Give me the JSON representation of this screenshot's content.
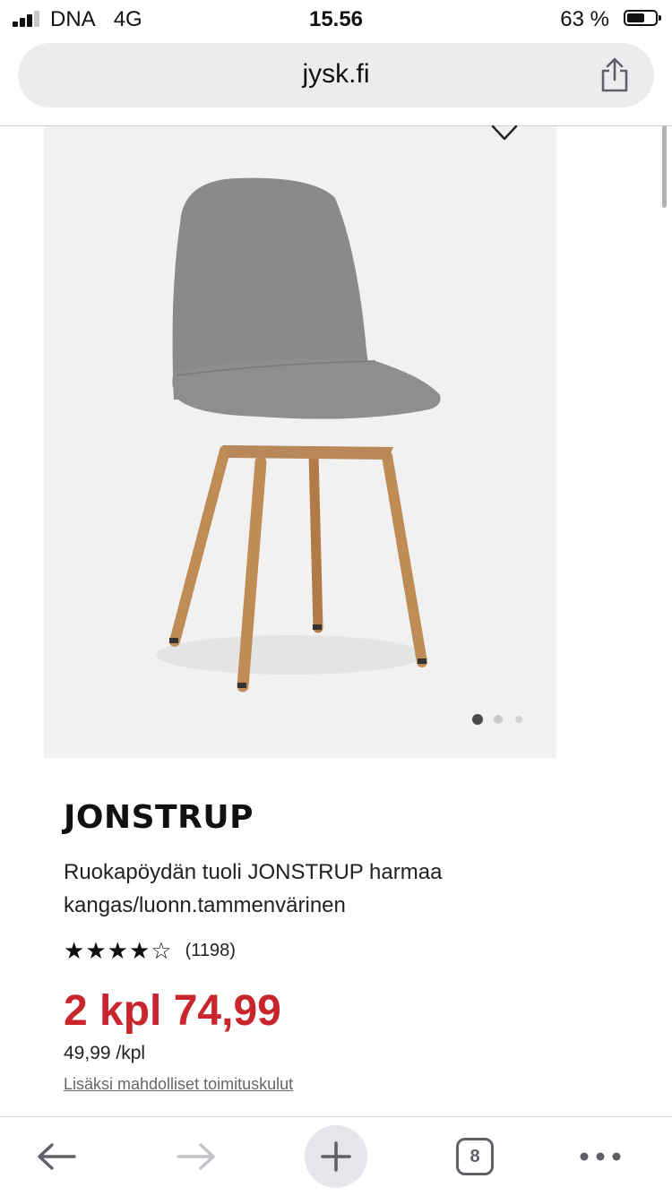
{
  "status_bar": {
    "carrier": "DNA",
    "network": "4G",
    "time": "15.56",
    "battery_percent": "63 %",
    "battery_level": 0.63,
    "signal_bars": 3
  },
  "browser": {
    "url": "jysk.fi",
    "share_icon": "share-icon",
    "tab_count": "8"
  },
  "gallery": {
    "wishlist_icon": "heart-outline-icon",
    "image_alt": "JONSTRUP dining chair grey fabric oak-look legs",
    "dots_total": 3,
    "dots_active": 0
  },
  "product": {
    "name": "JONSTRUP",
    "description": "Ruokapöydän tuoli JONSTRUP harmaa kangas/luonn.tammenvärinen",
    "rating": 4.5,
    "rating_count": "(1198)",
    "price": "2 kpl 74,99",
    "unit_price": "49,99 /kpl",
    "shipping_note": "Lisäksi mahdolliset toimituskulut"
  },
  "colors": {
    "price_red": "#c8252c",
    "image_bg": "#f1f1f1",
    "url_bar_bg": "#ececee",
    "chair_fabric": "#8a8a8c",
    "chair_legs": "#c08c55"
  },
  "toolbar": {
    "back_icon": "arrow-left-icon",
    "forward_icon": "arrow-right-icon",
    "new_tab_icon": "plus-icon",
    "tabs_icon": "tabs-icon",
    "more_icon": "more-dots-icon"
  }
}
